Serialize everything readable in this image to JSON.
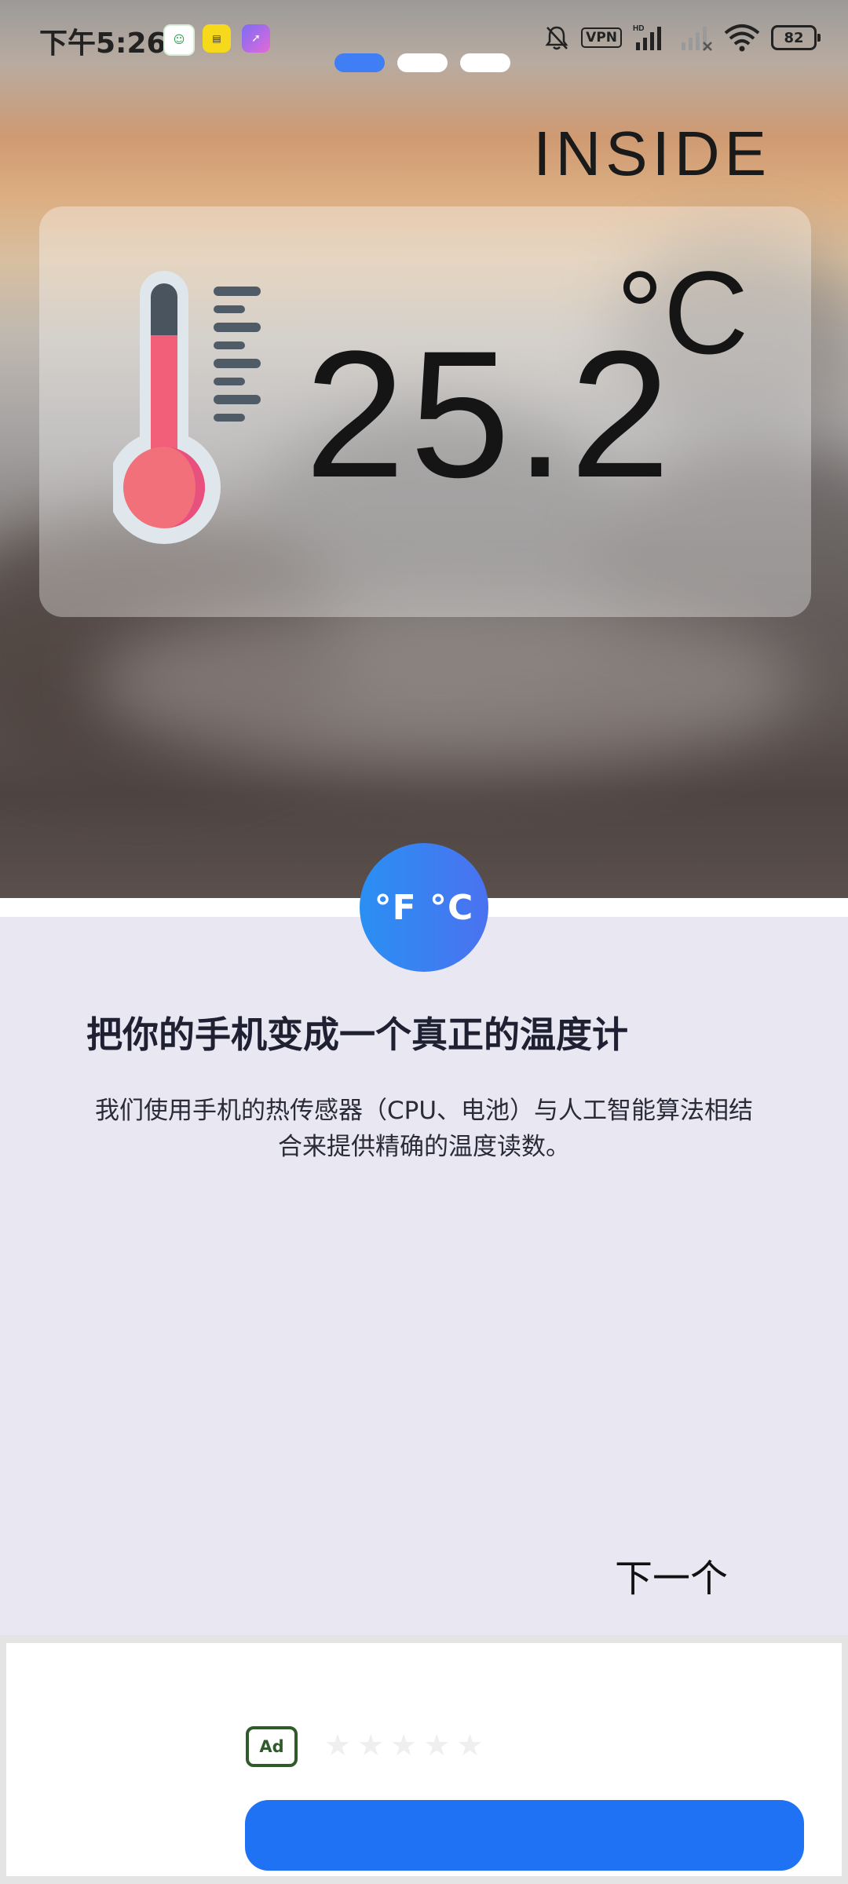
{
  "status_bar": {
    "time": "下午5:26",
    "app_icons": [
      "alien-app-icon",
      "yellow-app-icon",
      "rocket-app-icon"
    ],
    "vpn": "VPN",
    "network_label": "HD",
    "battery": "82",
    "right_icons": [
      "mute-bell-icon",
      "signal-icon",
      "signal-off-icon",
      "wifi-icon"
    ]
  },
  "pager": {
    "count": 3,
    "active_index": 0,
    "active_color": "#3f7ef4"
  },
  "hero": {
    "location_label": "INSIDE",
    "temperature": "25.2",
    "unit": "°C",
    "icon": "thermometer-icon"
  },
  "badge": {
    "text": "°F °C",
    "icon": "unit-toggle-icon"
  },
  "onboarding": {
    "headline": "把你的手机变成一个真正的温度计",
    "description": "我们使用手机的热传感器（CPU、电池）与人工智能算法相结合来提供精确的温度读数。",
    "next_label": "下一个"
  },
  "ad": {
    "tag": "Ad",
    "stars": [
      "★",
      "★",
      "★",
      "★",
      "★"
    ],
    "cta_label": "",
    "cta_color": "#2072f4"
  }
}
